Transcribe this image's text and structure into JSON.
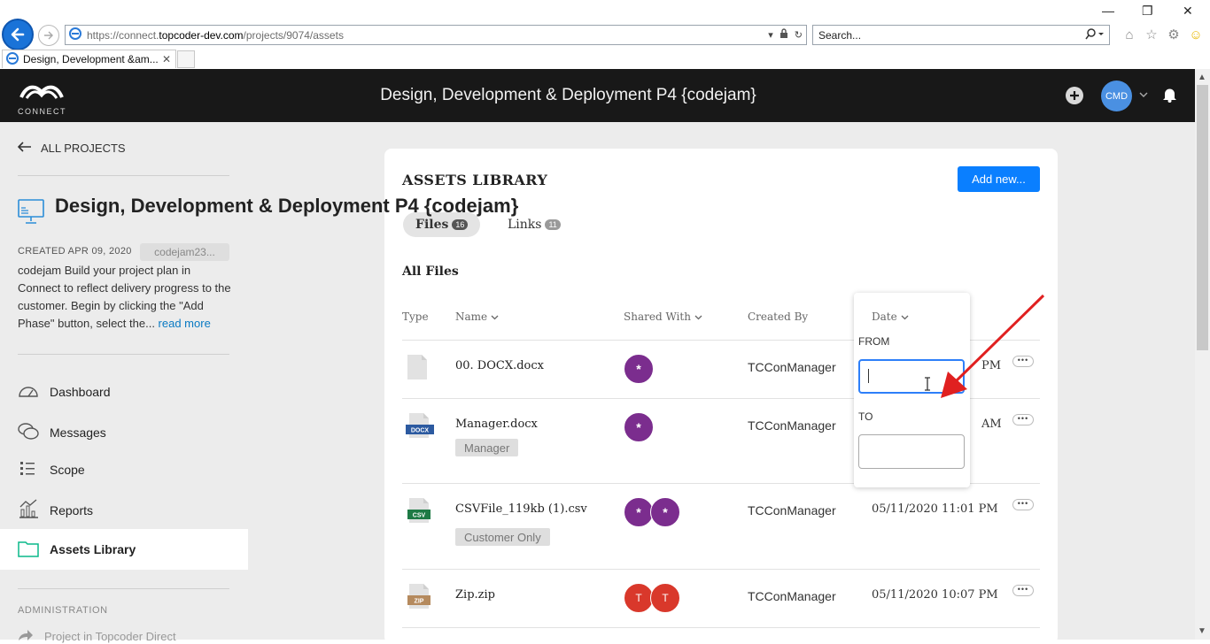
{
  "browser": {
    "url_domain_prefix": "https://connect.",
    "url_domain": "topcoder-dev.com",
    "url_path": "/projects/9074/assets",
    "search_placeholder": "Search...",
    "tab_title": "Design, Development &am...",
    "tab_close": "✕"
  },
  "header": {
    "logo_text": "CONNECT",
    "title": "Design, Development & Deployment P4 {codejam}",
    "avatar_initials": "CMD"
  },
  "sidebar": {
    "back_label": "ALL PROJECTS",
    "project_title": "Design, Development & Deployment P4 {codejam}",
    "created": "CREATED APR 09, 2020",
    "tag": "codejam23...",
    "description": "codejam Build your project plan in Connect to reflect delivery progress to the customer. Begin by clicking the \"Add Phase\" button, select the... ",
    "read_more": "read more",
    "nav": [
      {
        "label": "Dashboard",
        "icon": "dashboard-icon"
      },
      {
        "label": "Messages",
        "icon": "messages-icon"
      },
      {
        "label": "Scope",
        "icon": "scope-icon"
      },
      {
        "label": "Reports",
        "icon": "reports-icon"
      },
      {
        "label": "Assets Library",
        "icon": "folder-icon"
      }
    ],
    "admin_label": "ADMINISTRATION",
    "admin_link": "Project in Topcoder Direct"
  },
  "assets": {
    "title": "ASSETS LIBRARY",
    "add_new": "Add new...",
    "tabs": [
      {
        "label": "Files",
        "count": "16"
      },
      {
        "label": "Links",
        "count": "11"
      }
    ],
    "section_title": "All Files",
    "columns": {
      "type": "Type",
      "name": "Name",
      "shared_with": "Shared With",
      "created_by": "Created By",
      "date": "Date"
    },
    "files": [
      {
        "name": "00. DOCX.docx",
        "tag": "",
        "icon": "DOC",
        "shared": [
          "*"
        ],
        "created_by": "TCConManager",
        "date": "PM"
      },
      {
        "name": "Manager.docx",
        "tag": "Manager",
        "icon": "DOCX",
        "shared": [
          "*"
        ],
        "created_by": "TCConManager",
        "date": "AM"
      },
      {
        "name": "CSVFile_119kb (1).csv",
        "tag": "Customer Only",
        "icon": "CSV",
        "shared": [
          "*",
          "*"
        ],
        "created_by": "TCConManager",
        "date": "05/11/2020 11:01 PM"
      },
      {
        "name": "Zip.zip",
        "tag": "",
        "icon": "ZIP",
        "shared": [
          "T",
          "T"
        ],
        "created_by": "TCConManager",
        "date": "05/11/2020 10:07 PM"
      }
    ],
    "more_label": "•••"
  },
  "date_filter": {
    "header": "Date",
    "from_label": "FROM",
    "to_label": "TO",
    "from_value": "",
    "to_value": ""
  },
  "colors": {
    "header_bg": "#181818",
    "accent": "#0a7fff",
    "avatar_blue": "#4a90e2",
    "share_purple": "#7b2d8e",
    "share_red": "#d9382b",
    "annotation_arrow": "#e02020"
  }
}
